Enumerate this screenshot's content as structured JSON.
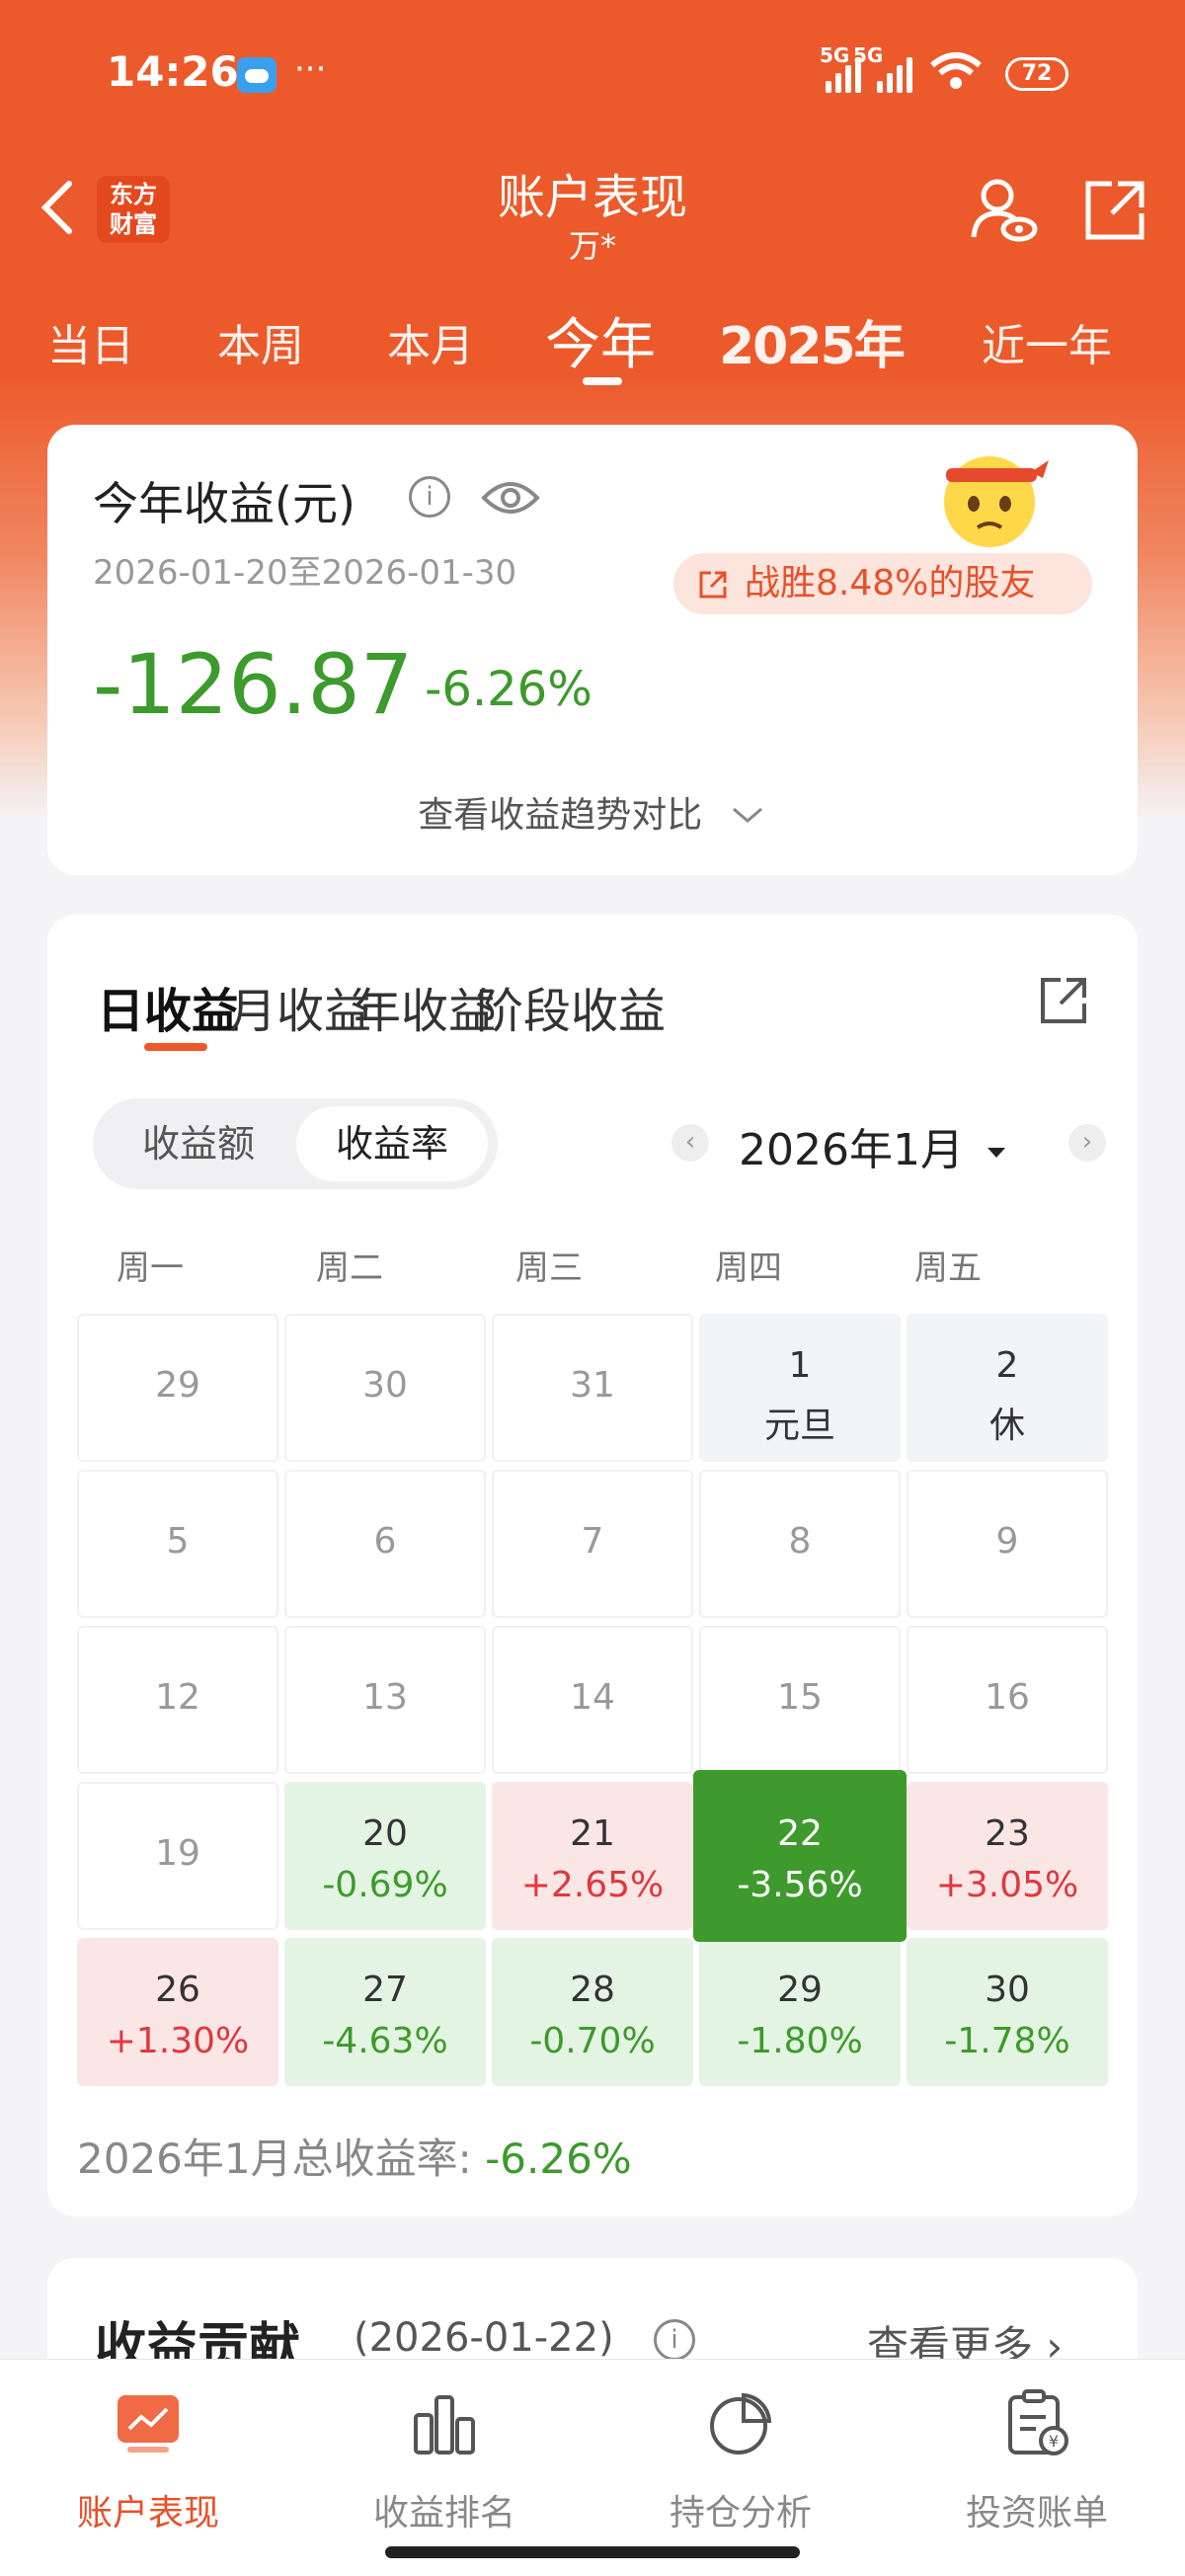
{
  "status_bar": {
    "time": "14:26",
    "dots": "···",
    "sig1_label": "5G",
    "sig2_label": "5G",
    "battery": "72"
  },
  "header": {
    "title": "账户表现",
    "subtitle": "万*",
    "logo": "东方\n财富"
  },
  "period_tabs": [
    {
      "label": "当日"
    },
    {
      "label": "本周"
    },
    {
      "label": "本月"
    },
    {
      "label": "今年",
      "active": true
    },
    {
      "label": "2025年"
    },
    {
      "label": "近一年"
    }
  ],
  "summary": {
    "heading": "今年收益(元)",
    "date_range": "2026-01-20至2026-01-30",
    "beat_text": "战胜8.48%的股友",
    "amount": "-126.87",
    "percent": "-6.26%",
    "trend_link": "查看收益趋势对比"
  },
  "returns": {
    "subtabs": [
      {
        "label": "日收益",
        "active": true
      },
      {
        "label": "月收益"
      },
      {
        "label": "年收益"
      },
      {
        "label": "阶段收益"
      }
    ],
    "toggle": {
      "amount_label": "收益额",
      "rate_label": "收益率",
      "selected": "收益率"
    },
    "month_label": "2026年1月",
    "month_prev": "‹",
    "month_next": "›",
    "weekdays": [
      "周一",
      "周二",
      "周三",
      "周四",
      "周五"
    ],
    "calendar": [
      [
        {
          "day": "29"
        },
        {
          "day": "30"
        },
        {
          "day": "31"
        },
        {
          "day": "1",
          "note": "元旦",
          "type": "hol"
        },
        {
          "day": "2",
          "note": "休",
          "type": "hol"
        }
      ],
      [
        {
          "day": "5"
        },
        {
          "day": "6"
        },
        {
          "day": "7"
        },
        {
          "day": "8"
        },
        {
          "day": "9"
        }
      ],
      [
        {
          "day": "12"
        },
        {
          "day": "13"
        },
        {
          "day": "14"
        },
        {
          "day": "15"
        },
        {
          "day": "16"
        }
      ],
      [
        {
          "day": "19"
        },
        {
          "day": "20",
          "note": "-0.69%",
          "type": "loss"
        },
        {
          "day": "21",
          "note": "+2.65%",
          "type": "gain"
        },
        {
          "day": "22",
          "note": "-3.56%",
          "type": "sel"
        },
        {
          "day": "23",
          "note": "+3.05%",
          "type": "gain"
        }
      ],
      [
        {
          "day": "26",
          "note": "+1.30%",
          "type": "gain"
        },
        {
          "day": "27",
          "note": "-4.63%",
          "type": "loss"
        },
        {
          "day": "28",
          "note": "-0.70%",
          "type": "loss"
        },
        {
          "day": "29",
          "note": "-1.80%",
          "type": "loss"
        },
        {
          "day": "30",
          "note": "-1.78%",
          "type": "loss"
        }
      ]
    ],
    "total_label": "2026年1月总收益率: ",
    "total_value": "-6.26%"
  },
  "contribution": {
    "heading": "收益贡献",
    "date": "(2026-01-22)",
    "more": "查看更多 ›"
  },
  "bottom_nav": [
    {
      "label": "账户表现",
      "icon": "chart-icon",
      "active": true
    },
    {
      "label": "收益排名",
      "icon": "bar-chart-icon"
    },
    {
      "label": "持仓分析",
      "icon": "pie-chart-icon"
    },
    {
      "label": "投资账单",
      "icon": "bill-icon"
    }
  ],
  "colors": {
    "brand": "#ec5a2b",
    "loss": "#3d9a2c",
    "gain": "#e0373d",
    "selected_cell": "#3f9a2e"
  }
}
